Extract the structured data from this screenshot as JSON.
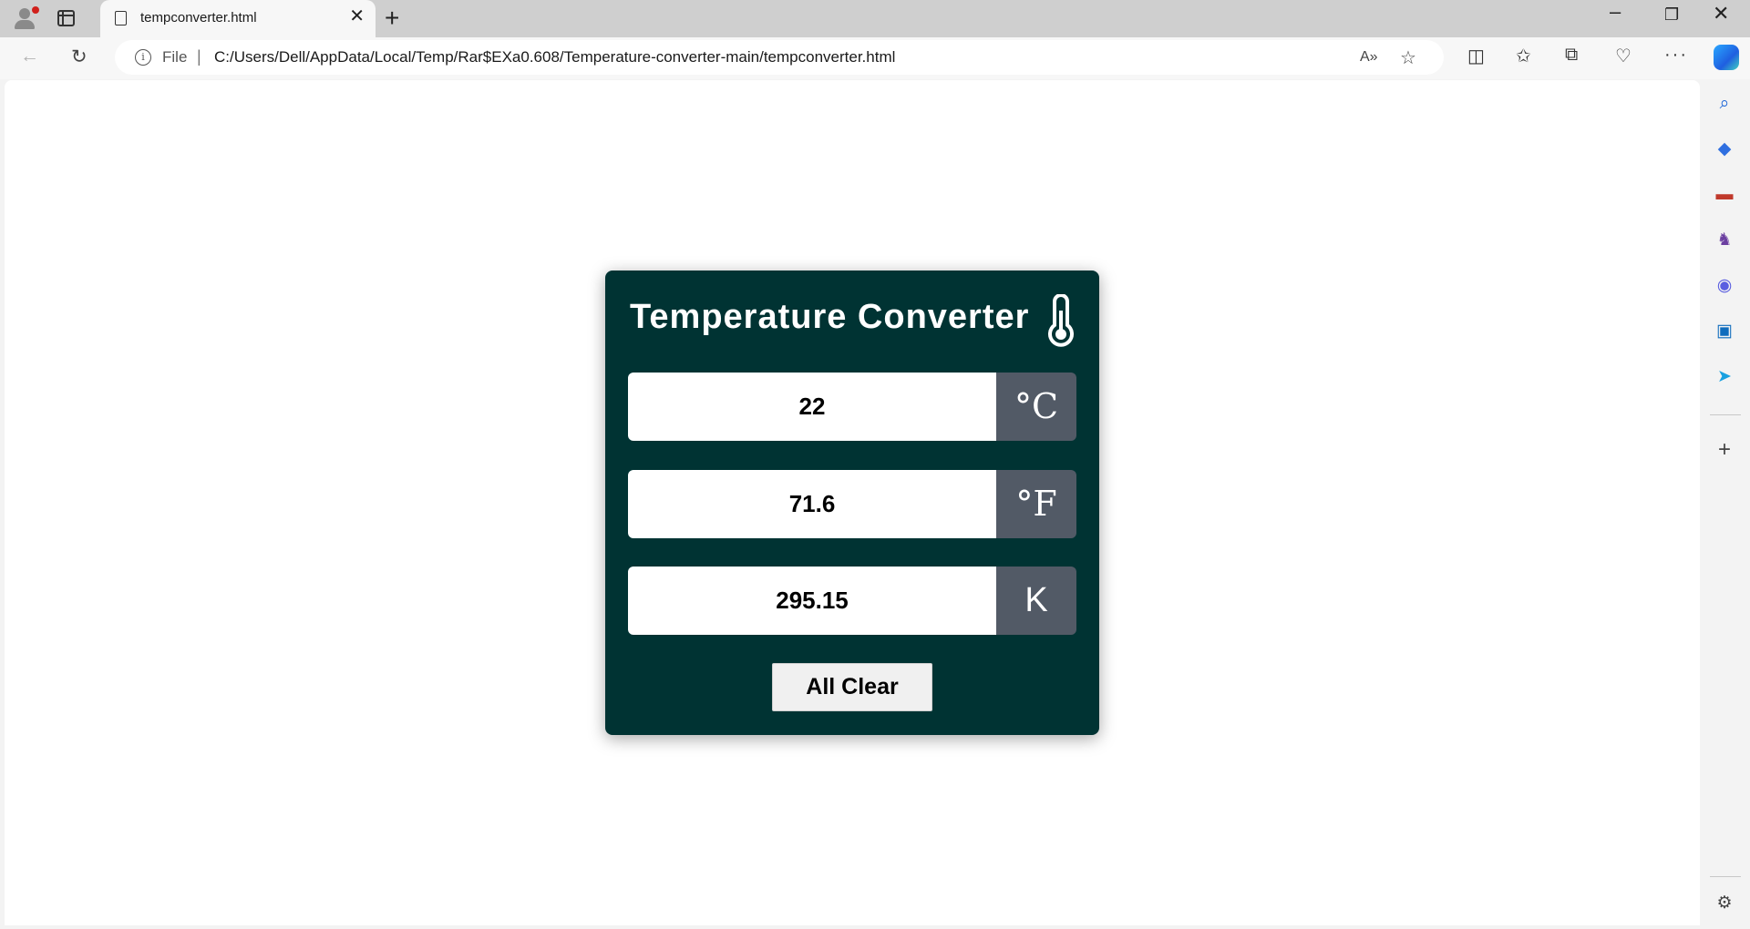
{
  "browser": {
    "tab_title": "tempconverter.html",
    "new_tab_label": "+",
    "tab_close": "✕",
    "scheme_label": "File",
    "url": "C:/Users/Dell/AppData/Local/Temp/Rar$EXa0.608/Temperature-converter-main/tempconverter.html"
  },
  "converter": {
    "title": "Temperature Converter",
    "celsius": {
      "value": "22",
      "unit": "°C"
    },
    "fahrenheit": {
      "value": "71.6",
      "unit": "°F"
    },
    "kelvin": {
      "value": "295.15",
      "unit": "K"
    },
    "clear_label": "All Clear",
    "colors": {
      "card_bg": "#003333",
      "unit_bg": "#525a66",
      "text": "#ffffff"
    }
  },
  "sidebar_icons": [
    "search-icon",
    "shopping-icon",
    "tools-icon",
    "games-icon",
    "microsoft365-icon",
    "outlook-icon",
    "send-icon",
    "add-icon",
    "settings-icon"
  ]
}
